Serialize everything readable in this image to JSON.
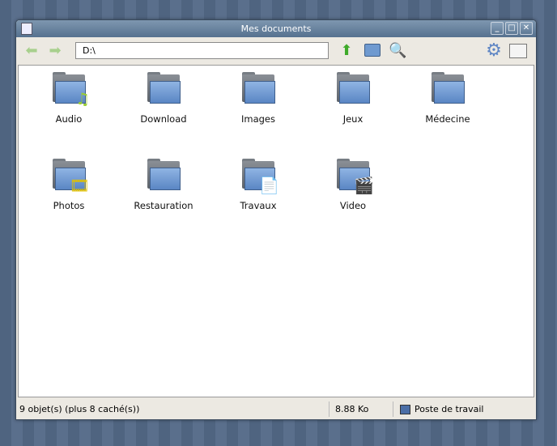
{
  "window": {
    "title": "Mes documents",
    "controls": {
      "minimize": "_",
      "maximize": "□",
      "close": "✕"
    }
  },
  "toolbar": {
    "address": "D:\\",
    "icons": [
      "back-arrow-icon",
      "forward-arrow-icon",
      "up-arrow-icon",
      "folder-icon",
      "search-icon",
      "settings-gear-icon",
      "view-mode-icon"
    ]
  },
  "items": [
    {
      "label": "Audio",
      "emblem": "♫",
      "emblem_color": "#9acd32"
    },
    {
      "label": "Download",
      "emblem": ""
    },
    {
      "label": "Images",
      "emblem": ""
    },
    {
      "label": "Jeux",
      "emblem": ""
    },
    {
      "label": "Médecine",
      "emblem": ""
    },
    {
      "label": "Photos",
      "emblem": "🎞",
      "emblem_color": "#e0c000"
    },
    {
      "label": "Restauration",
      "emblem": ""
    },
    {
      "label": "Travaux",
      "emblem": "📄",
      "emblem_color": "#ccc"
    },
    {
      "label": "Video",
      "emblem": "🎬",
      "emblem_color": "#666"
    }
  ],
  "status": {
    "count": "9 objet(s) (plus 8 caché(s))",
    "size": "8.88 Ko",
    "location": "Poste de travail"
  }
}
